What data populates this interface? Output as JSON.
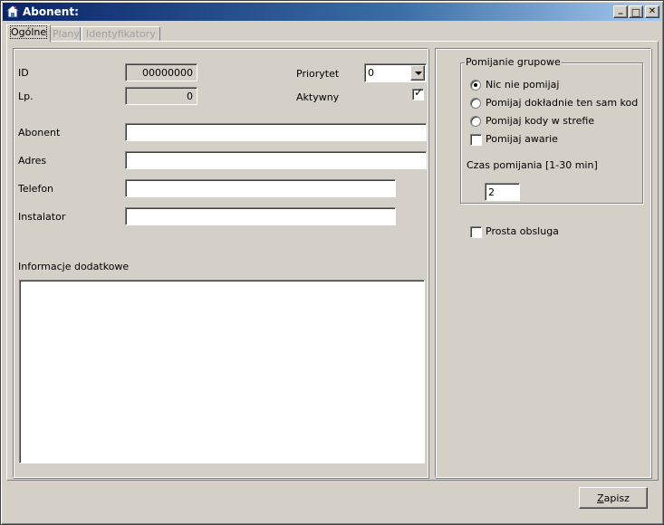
{
  "window": {
    "title": "Abonent:"
  },
  "titlebar_buttons": {
    "minimize": "_",
    "maximize": "□",
    "close": "✕"
  },
  "tabs": [
    {
      "label": "Ogólne",
      "state": "active"
    },
    {
      "label": "Plany",
      "state": "disabled"
    },
    {
      "label": "Identyfikatory",
      "state": "disabled"
    }
  ],
  "general": {
    "id_label": "ID",
    "id_value": "00000000",
    "lp_label": "Lp.",
    "lp_value": "0",
    "priority_label": "Priorytet",
    "priority_value": "0",
    "active_label": "Aktywny",
    "active_checked": true,
    "abonent_label": "Abonent",
    "abonent_value": "",
    "adres_label": "Adres",
    "adres_value": "",
    "telefon_label": "Telefon",
    "telefon_value": "",
    "instalator_label": "Instalator",
    "instalator_value": "",
    "info_label": "Informacje dodatkowe",
    "info_value": ""
  },
  "group_skip": {
    "title": "Pomijanie grupowe",
    "options": [
      {
        "label": "Nic nie pomijaj",
        "selected": true
      },
      {
        "label": "Pomijaj dokładnie ten sam kod",
        "selected": false
      },
      {
        "label": "Pomijaj kody w strefie",
        "selected": false
      }
    ],
    "skip_failures_label": "Pomijaj awarie",
    "skip_failures_checked": false,
    "time_label": "Czas pomijania [1-30 min]",
    "time_value": "2"
  },
  "simple_service": {
    "label": "Prosta obsluga",
    "checked": false
  },
  "buttons": {
    "save_first": "Z",
    "save_rest": "apisz"
  }
}
